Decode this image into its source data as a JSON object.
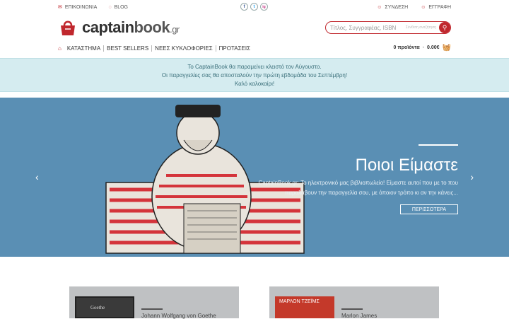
{
  "top": {
    "contact": "ΕΠΙΚΟΙΝΩΝΙΑ",
    "blog": "BLOG",
    "login": "ΣΥΝΔΕΣΗ",
    "register": "ΕΓΓΡΑΦΗ",
    "social": [
      "f",
      "t",
      "ig"
    ]
  },
  "logo": {
    "main": "captain",
    "book": "book",
    "tld": ".gr"
  },
  "search": {
    "placeholder": "Τίτλος, Συγγραφέας, ISBN",
    "advanced": "Σύνθετη αναζήτηση"
  },
  "nav": {
    "items": [
      "ΚΑΤΑΣΤΗΜΑ",
      "BEST SELLERS",
      "ΝΕΕΣ ΚΥΚΛΟΦΟΡΙΕΣ",
      "ΠΡΟΤΑΣΕΙΣ"
    ],
    "cart_count": "0 προϊόντα",
    "cart_total": "0.00€"
  },
  "notice": {
    "line1": "Το CaptainBook θα παραμείνει κλειστό τον Αύγουστο.",
    "line2": "Οι παραγγελίες σας θα αποσταλούν την πρώτη εβδομάδα του Σεπτέμβρη!",
    "line3": "Καλό καλοκαίρι!"
  },
  "hero": {
    "title": "Ποιοι Είμαστε",
    "description": "CaptainBook.gr: Το ηλεκτρονικό μας βιβλιοπωλείο! Είμαστε αυτοί που με το που παραλάβουν την παραγγελία σου, με όποιον τρόπο κι αν την κάνεις...",
    "button": "ΠΕΡΙΣΣΟΤΕΡΑ",
    "prev": "‹",
    "next": "›"
  },
  "cards": [
    {
      "author": "Johann Wolfgang von Goethe",
      "cover_text": "Goethe"
    },
    {
      "author": "Marlon James",
      "cover_text": "ΜΑΡΛΟΝ ΤΖΕΪΜΣ"
    }
  ],
  "colors": {
    "brand": "#c0272d",
    "hero_bg": "#5a8fb4",
    "notice_bg": "#d5ecf0"
  }
}
